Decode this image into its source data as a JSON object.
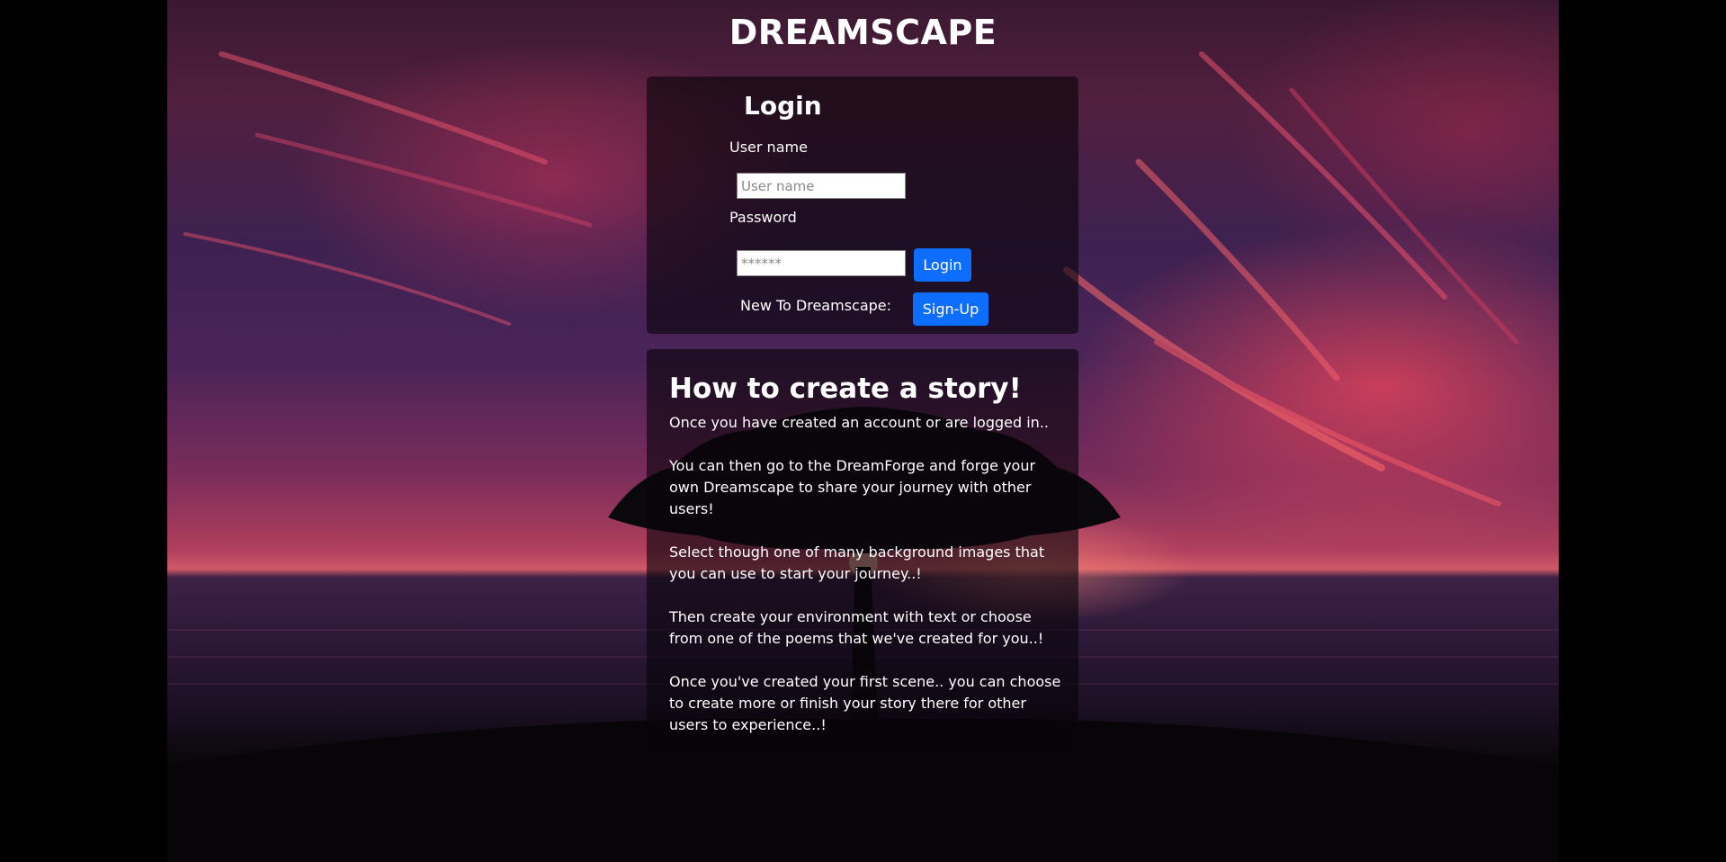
{
  "header": {
    "title": "DREAMSCAPE"
  },
  "login": {
    "heading": "Login",
    "username_label": "User name",
    "username_placeholder": "User name",
    "password_label": "Password",
    "password_placeholder": "******",
    "login_button": "Login",
    "new_user_text": "New To Dreamscape:",
    "signup_button": "Sign-Up"
  },
  "story": {
    "heading": "How to create a story!",
    "paragraphs": [
      "Once you have created an account or are logged in..",
      "You can then go to the DreamForge and forge your own Dreamscape to share your journey with other users!",
      "Select though one of many background images that you can use to start your journey..!",
      "Then create your environment with text or choose from one of the poems that we've created for you..!",
      "Once you've created your first scene.. you can choose to create more or finish your story there for other users to experience..!"
    ]
  },
  "colors": {
    "accent": "#0d6efd",
    "page_background": "#000000",
    "panel_background": "rgba(8,4,10,0.62)"
  }
}
